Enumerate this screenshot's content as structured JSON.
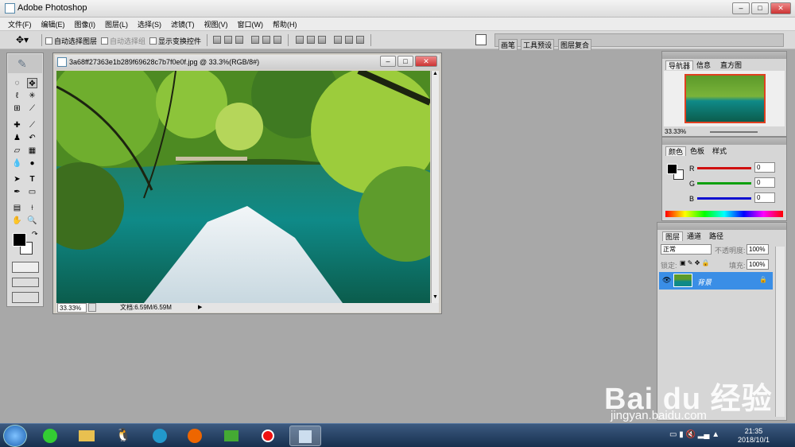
{
  "app": {
    "title": "Adobe Photoshop",
    "min": "–",
    "max": "□",
    "close": "✕"
  },
  "menu": [
    "文件(F)",
    "编辑(E)",
    "图像(I)",
    "图层(L)",
    "选择(S)",
    "滤镜(T)",
    "视图(V)",
    "窗口(W)",
    "帮助(H)"
  ],
  "options": {
    "auto_select_layer": "自动选择图层",
    "auto_select_group": "自动选择组",
    "show_transform": "显示变换控件"
  },
  "wells": [
    "画笔",
    "工具预设",
    "图层复合"
  ],
  "document": {
    "title": "3a68ff27363e1b289f69628c7b7f0e0f.jpg @ 33.3%(RGB/8#)",
    "zoom": "33.33%",
    "doc_info": "文档:6.59M/6.59M"
  },
  "navigator": {
    "tabs": [
      "导航器",
      "信息",
      "直方图"
    ],
    "zoom": "33.33%"
  },
  "color": {
    "tabs": [
      "颜色",
      "色板",
      "样式"
    ],
    "r_label": "R",
    "g_label": "G",
    "b_label": "B",
    "r": "0",
    "g": "0",
    "b": "0",
    "r_color": "#d01010",
    "g_color": "#10a010",
    "b_color": "#1010d0"
  },
  "layers": {
    "tabs": [
      "图层",
      "通道",
      "路径"
    ],
    "blend_mode": "正常",
    "opacity_label": "不透明度:",
    "opacity": "100%",
    "lock_label": "锁定:",
    "fill_label": "填充:",
    "fill": "100%",
    "layer_name": "背景"
  },
  "taskbar": {
    "time": "21:35",
    "date": "2018/10/1"
  },
  "watermark": {
    "brand": "Bai du 经验",
    "url": "jingyan.baidu.com"
  }
}
